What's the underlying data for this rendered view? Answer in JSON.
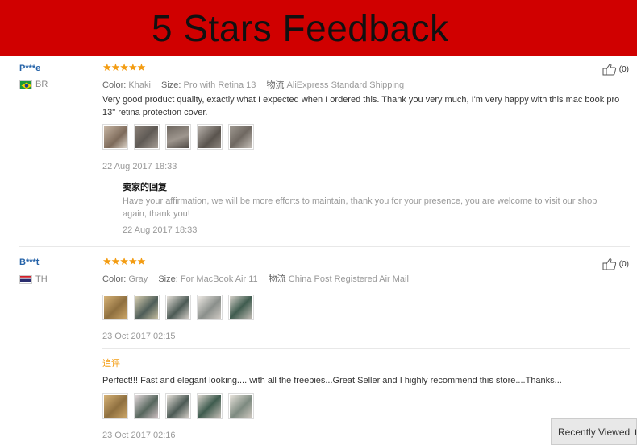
{
  "banner": {
    "title": "5 Stars Feedback",
    "bg": "#d00000"
  },
  "reviews": [
    {
      "user": "P***e",
      "country": "BR",
      "stars": "★★★★★",
      "color_label": "Color:",
      "color_value": "Khaki",
      "size_label": "Size:",
      "size_value": "Pro with Retina 13",
      "ship_label": "物流",
      "ship_value": "AliExpress Standard Shipping",
      "text": "Very good product quality, exactly what I expected when I ordered this. Thank you very much, I'm very happy with this mac book pro 13\" retina protection cover.",
      "date": "22 Aug 2017 18:33",
      "helpful": "(0)",
      "seller_reply_title": "卖家的回复",
      "seller_reply_text": "Have your affirmation, we will be more efforts to maintain, thank you for your presence, you are welcome to visit our shop again, thank you!",
      "seller_reply_date": "22 Aug 2017 18:33"
    },
    {
      "user": "B***t",
      "country": "TH",
      "stars": "★★★★★",
      "color_label": "Color:",
      "color_value": "Gray",
      "size_label": "Size:",
      "size_value": "For MacBook Air 11",
      "ship_label": "物流",
      "ship_value": "China Post Registered Air Mail",
      "date": "23 Oct 2017 02:15",
      "helpful": "(0)",
      "followup_label": "追评",
      "followup_text": "Perfect!!! Fast and elegant looking.... with all the freebies...Great Seller and I highly recommend this store....Thanks...",
      "followup_date": "23 Oct 2017 02:16"
    }
  ],
  "recently_viewed": "Recently Viewed"
}
